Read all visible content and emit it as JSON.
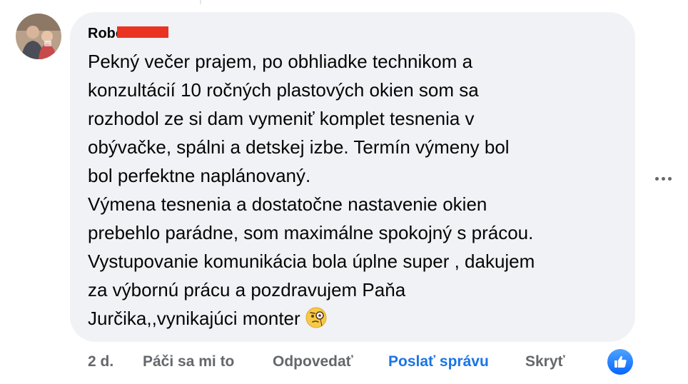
{
  "comment": {
    "author_name": "Robo",
    "body_lines": [
      "Pekný večer prajem, po obhliadke technikom a",
      "konzultácií 10 ročných plastových okien som sa",
      "rozhodol ze si dam vymeniť komplet tesnenia v",
      "obývačke, spálni a detskej izbe. Termín výmeny bol",
      "bol perfektne naplánovaný.",
      "Výmena tesnenia a dostatočne nastavenie okien",
      "prebehlo parádne, som maximálne spokojný s prácou.",
      "Vystupovanie komunikácia bola úplne super , dakujem",
      "za výbornú prácu a pozdravujem Paňa",
      "Jurčika,,vynikajúci monter"
    ],
    "emoji": "face-with-monocle-emoji",
    "more_icon": "more-options-icon"
  },
  "actions": {
    "timestamp": "2 d.",
    "like_label": "Páči sa mi to",
    "reply_label": "Odpovedať",
    "message_label": "Poslať správu",
    "hide_label": "Skryť"
  },
  "reaction": {
    "icon": "thumbs-up-icon",
    "color": "#0866ff"
  },
  "colors": {
    "bubble": "#f0f2f5",
    "text": "#050505",
    "muted": "#65676b",
    "accent": "#1b74e4",
    "redaction": "#ea3323"
  }
}
